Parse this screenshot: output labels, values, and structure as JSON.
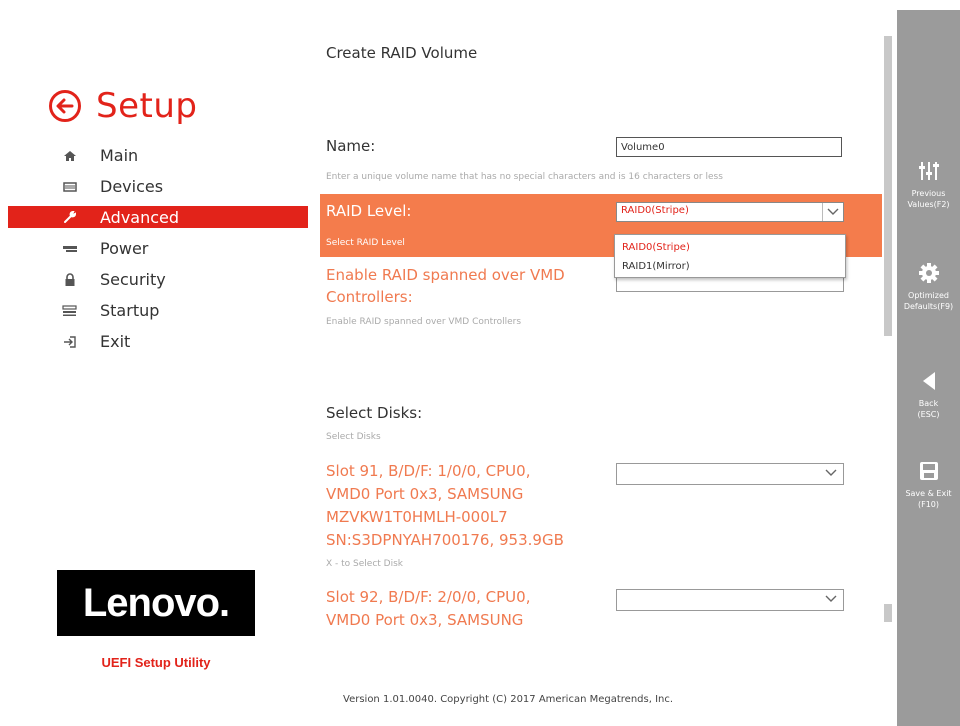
{
  "setup_title": "Setup",
  "nav": [
    {
      "label": "Main",
      "icon": "home-icon"
    },
    {
      "label": "Devices",
      "icon": "devices-icon"
    },
    {
      "label": "Advanced",
      "icon": "wrench-icon",
      "active": true
    },
    {
      "label": "Power",
      "icon": "power-icon"
    },
    {
      "label": "Security",
      "icon": "lock-icon"
    },
    {
      "label": "Startup",
      "icon": "startup-icon"
    },
    {
      "label": "Exit",
      "icon": "exit-icon"
    }
  ],
  "logo": {
    "text": "Lenovo.",
    "subtitle": "UEFI Setup Utility"
  },
  "main": {
    "title": "Create RAID Volume",
    "name_label": "Name:",
    "name_value": "Volume0",
    "name_help": "Enter a unique volume name that has no special characters and is 16 characters or less",
    "raid_label": "RAID Level:",
    "raid_help": "Select RAID Level",
    "raid_value": "RAID0(Stripe)",
    "raid_options": [
      "RAID0(Stripe)",
      "RAID1(Mirror)"
    ],
    "vmd_label_line1": "Enable RAID spanned over VMD",
    "vmd_label_line2": "Controllers:",
    "vmd_help": "Enable RAID spanned over VMD Controllers",
    "select_disks_label": "Select Disks:",
    "select_disks_help": "Select Disks",
    "disk1_lines": [
      "Slot 91, B/D/F: 1/0/0, CPU0,",
      "VMD0 Port 0x3, SAMSUNG",
      "MZVKW1T0HMLH-000L7",
      "SN:S3DPNYAH700176, 953.9GB"
    ],
    "disk1_help": "X - to Select Disk",
    "disk2_lines": [
      "Slot 92, B/D/F: 2/0/0, CPU0,",
      "VMD0 Port 0x3, SAMSUNG"
    ]
  },
  "version": "Version 1.01.0040. Copyright (C) 2017 American Megatrends, Inc.",
  "actions": [
    {
      "icon": "sliders-icon",
      "line1": "Previous",
      "line2": "Values(F2)"
    },
    {
      "icon": "gear-icon",
      "line1": "Optimized",
      "line2": "Defaults(F9)"
    },
    {
      "icon": "back-arrow-icon",
      "line1": "Back",
      "line2": "(ESC)"
    },
    {
      "icon": "save-icon",
      "line1": "Save & Exit",
      "line2": "(F10)"
    }
  ],
  "colors": {
    "accent": "#e2231a",
    "highlight": "#f47c4c",
    "orange_text": "#f07a50",
    "rightbar": "#9b9b9b"
  }
}
